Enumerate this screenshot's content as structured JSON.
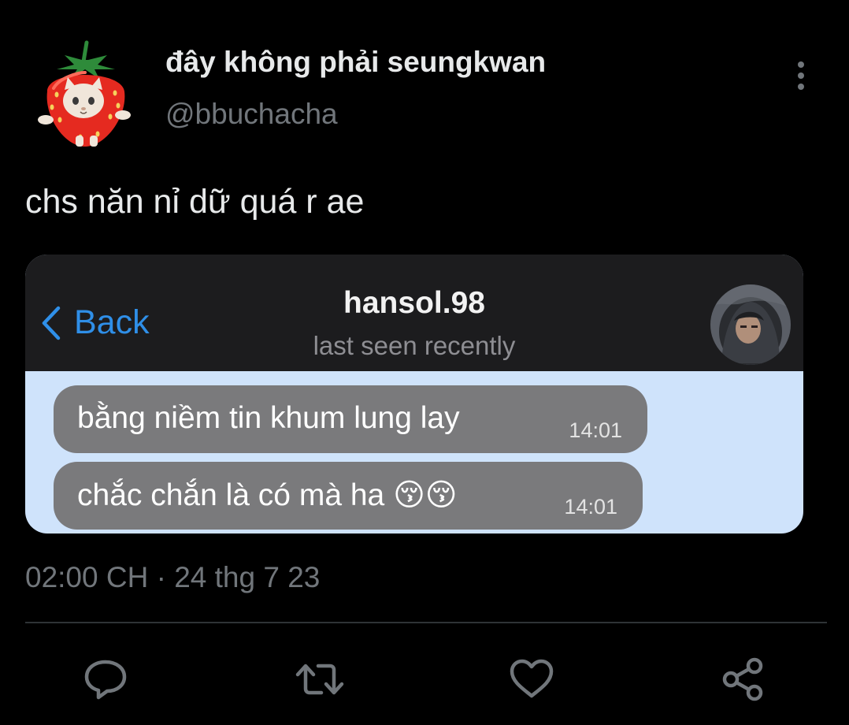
{
  "tweet": {
    "display_name": "đây không phải seungkwan",
    "handle": "@bbuchacha",
    "text": "chs năn nỉ dữ quá r ae",
    "timestamp": "02:00 CH · 24 thg 7 23",
    "avatar_icon": "strawberry-cat-avatar",
    "more_icon": "more-vertical-icon"
  },
  "embedded_chat": {
    "back_label": "Back",
    "contact_name": "hansol.98",
    "status": "last seen recently",
    "accent_color": "#2f8fe8",
    "bubble_color": "#7a7a7c",
    "background_color": "#cfe3fb",
    "messages": [
      {
        "text": "bằng niềm tin khum lung lay",
        "time": "14:01"
      },
      {
        "text": "chắc chắn là có mà ha 😚😚",
        "time": "14:01"
      }
    ]
  },
  "actions": [
    {
      "name": "reply",
      "icon": "reply-icon"
    },
    {
      "name": "retweet",
      "icon": "retweet-icon"
    },
    {
      "name": "like",
      "icon": "heart-icon"
    },
    {
      "name": "share",
      "icon": "share-icon"
    }
  ],
  "colors": {
    "background": "#000000",
    "primary_text": "#e7e9ea",
    "secondary_text": "#71767b",
    "divider": "#2f3336"
  }
}
